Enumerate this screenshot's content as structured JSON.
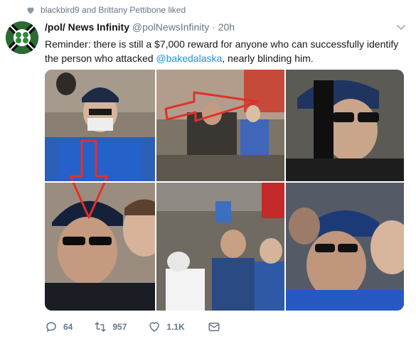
{
  "social_context": {
    "icon": "heart-icon",
    "text": "blackbird9 and Brittany Pettibone liked"
  },
  "tweet": {
    "display_name": "/pol/ News Infinity",
    "handle": "@polNewsInfinity",
    "separator": "·",
    "time": "20h",
    "text_before": "Reminder: there is still a $7,000 reward for anyone who can successfully identify the person who attacked ",
    "mention": "@bakedalaska",
    "text_after": ", nearly blinding him."
  },
  "actions": {
    "reply_count": "64",
    "retweet_count": "957",
    "like_count": "1.1K"
  },
  "colors": {
    "link": "#1b95e0",
    "muted": "#657786",
    "arrow": "#e0312a"
  }
}
